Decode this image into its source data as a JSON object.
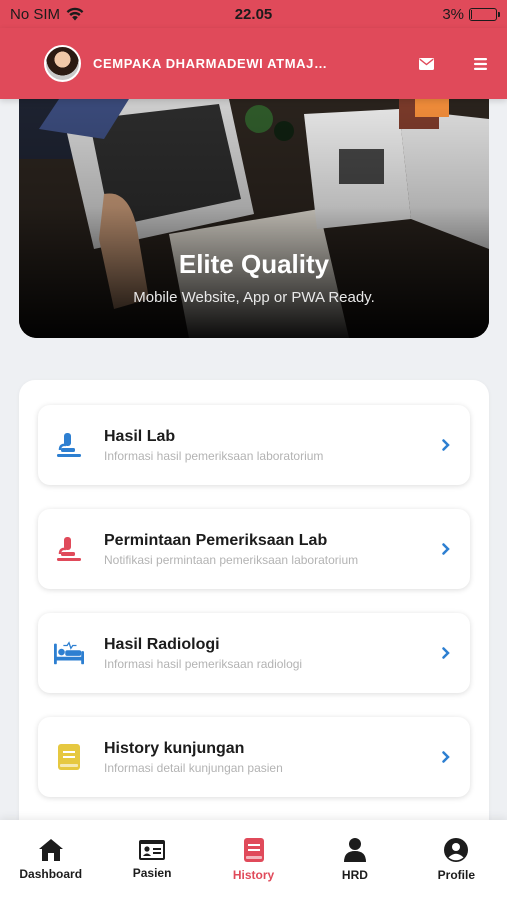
{
  "status_bar": {
    "carrier": "No SIM",
    "time": "22.05",
    "battery": "3%",
    "battery_level": 0.03
  },
  "header": {
    "user_name": "CEMPAKA DHARMADEWI ATMAJA N..."
  },
  "hero": {
    "title": "Elite Quality",
    "subtitle": "Mobile Website, App or PWA Ready."
  },
  "menu": [
    {
      "title": "Hasil Lab",
      "subtitle": "Informasi hasil pemeriksaan laboratorium",
      "icon": "microscope-icon",
      "color": "#2d7fd1"
    },
    {
      "title": "Permintaan Pemeriksaan Lab",
      "subtitle": "Notifikasi permintaan pemeriksaan laboratorium",
      "icon": "microscope-icon",
      "color": "#e04a5a"
    },
    {
      "title": "Hasil Radiologi",
      "subtitle": "Informasi hasil pemeriksaan radiologi",
      "icon": "hospital-bed-icon",
      "color": "#2d7fd1"
    },
    {
      "title": "History kunjungan",
      "subtitle": "Informasi detail kunjungan pasien",
      "icon": "book-icon",
      "color": "#e6c840"
    }
  ],
  "bottom_nav": [
    {
      "label": "Dashboard",
      "icon": "home-icon",
      "active": false
    },
    {
      "label": "Pasien",
      "icon": "id-card-icon",
      "active": false
    },
    {
      "label": "History",
      "icon": "book-icon",
      "active": true
    },
    {
      "label": "HRD",
      "icon": "person-icon",
      "active": false
    },
    {
      "label": "Profile",
      "icon": "user-circle-icon",
      "active": false
    }
  ],
  "colors": {
    "primary": "#e04a5a",
    "chevron": "#2d7fd1"
  }
}
